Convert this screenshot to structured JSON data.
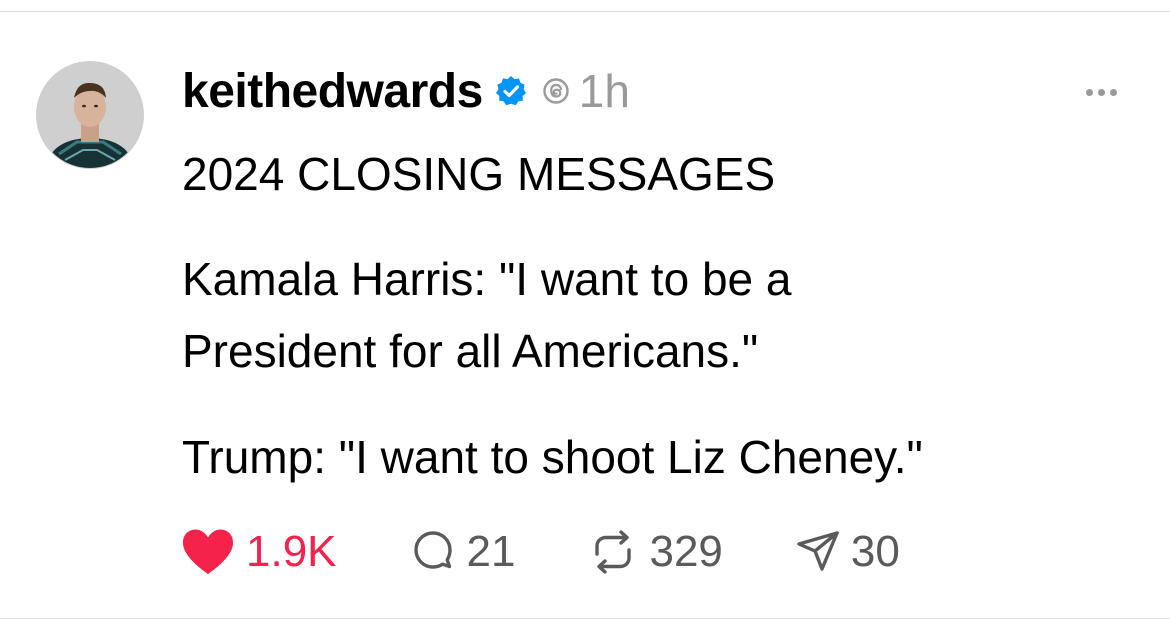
{
  "post": {
    "username": "keithedwards",
    "timestamp": "1h",
    "headline": "2024 CLOSING MESSAGES",
    "paragraph_1_line_1": "Kamala Harris: \"I want to be a",
    "paragraph_1_line_2": "President for all Americans.\"",
    "paragraph_2": "Trump: \"I want to shoot Liz Cheney.\""
  },
  "actions": {
    "likes": "1.9K",
    "replies": "21",
    "reposts": "329",
    "shares": "30"
  },
  "icons": {
    "verified": "verified-badge-icon",
    "thread": "threads-icon",
    "more": "more-icon",
    "like": "heart-icon",
    "reply": "comment-icon",
    "repost": "repost-icon",
    "share": "share-icon"
  },
  "colors": {
    "like_active": "#f5224c",
    "verified_blue": "#0095f6",
    "muted_text": "#9a9a9a",
    "counts": "#5a5a5a"
  }
}
